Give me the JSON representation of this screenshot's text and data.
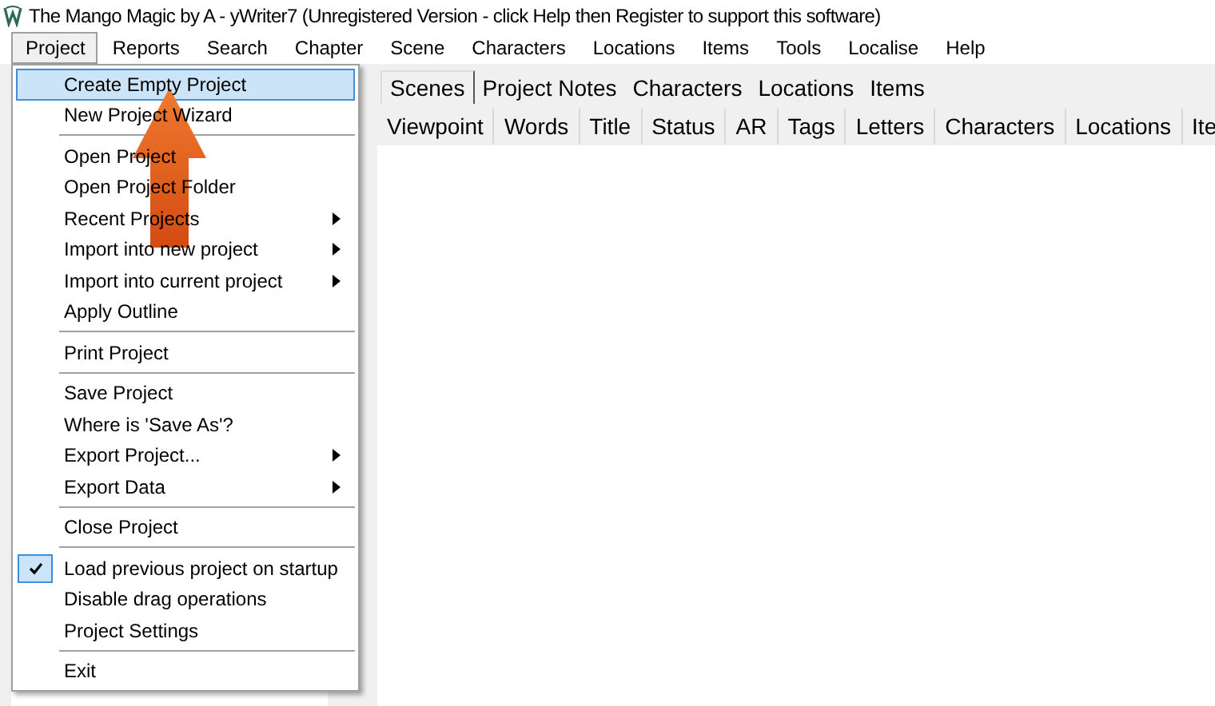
{
  "window": {
    "title": "The Mango Magic by A - yWriter7 (Unregistered Version - click Help then Register to support this software)"
  },
  "menubar": [
    {
      "label": "Project",
      "selected": true
    },
    {
      "label": "Reports",
      "selected": false
    },
    {
      "label": "Search",
      "selected": false
    },
    {
      "label": "Chapter",
      "selected": false
    },
    {
      "label": "Scene",
      "selected": false
    },
    {
      "label": "Characters",
      "selected": false
    },
    {
      "label": "Locations",
      "selected": false
    },
    {
      "label": "Items",
      "selected": false
    },
    {
      "label": "Tools",
      "selected": false
    },
    {
      "label": "Localise",
      "selected": false
    },
    {
      "label": "Help",
      "selected": false
    }
  ],
  "menu": [
    {
      "kind": "item",
      "label": "Create Empty Project",
      "selected": true,
      "submenu": false,
      "checked": false
    },
    {
      "kind": "item",
      "label": "New Project Wizard",
      "selected": false,
      "submenu": false,
      "checked": false
    },
    {
      "kind": "separator"
    },
    {
      "kind": "item",
      "label": "Open Project",
      "selected": false,
      "submenu": false,
      "checked": false
    },
    {
      "kind": "item",
      "label": "Open Project Folder",
      "selected": false,
      "submenu": false,
      "checked": false
    },
    {
      "kind": "item",
      "label": "Recent Projects",
      "selected": false,
      "submenu": true,
      "checked": false
    },
    {
      "kind": "item",
      "label": "Import into new project",
      "selected": false,
      "submenu": true,
      "checked": false
    },
    {
      "kind": "item",
      "label": "Import into current project",
      "selected": false,
      "submenu": true,
      "checked": false
    },
    {
      "kind": "item",
      "label": "Apply Outline",
      "selected": false,
      "submenu": false,
      "checked": false
    },
    {
      "kind": "separator"
    },
    {
      "kind": "item",
      "label": "Print Project",
      "selected": false,
      "submenu": false,
      "checked": false
    },
    {
      "kind": "separator"
    },
    {
      "kind": "item",
      "label": "Save Project",
      "selected": false,
      "submenu": false,
      "checked": false
    },
    {
      "kind": "item",
      "label": "Where is 'Save As'?",
      "selected": false,
      "submenu": false,
      "checked": false
    },
    {
      "kind": "item",
      "label": "Export Project...",
      "selected": false,
      "submenu": true,
      "checked": false
    },
    {
      "kind": "item",
      "label": "Export Data",
      "selected": false,
      "submenu": true,
      "checked": false
    },
    {
      "kind": "separator"
    },
    {
      "kind": "item",
      "label": "Close Project",
      "selected": false,
      "submenu": false,
      "checked": false
    },
    {
      "kind": "separator"
    },
    {
      "kind": "item",
      "label": "Load previous project on startup",
      "selected": false,
      "submenu": false,
      "checked": true
    },
    {
      "kind": "item",
      "label": "Disable drag operations",
      "selected": false,
      "submenu": false,
      "checked": false
    },
    {
      "kind": "item",
      "label": "Project Settings",
      "selected": false,
      "submenu": false,
      "checked": false
    },
    {
      "kind": "separator"
    },
    {
      "kind": "item",
      "label": "Exit",
      "selected": false,
      "submenu": false,
      "checked": false
    }
  ],
  "tabs": [
    {
      "label": "Scenes",
      "selected": true
    },
    {
      "label": "Project Notes",
      "selected": false
    },
    {
      "label": "Characters",
      "selected": false
    },
    {
      "label": "Locations",
      "selected": false
    },
    {
      "label": "Items",
      "selected": false
    }
  ],
  "table": {
    "columns": [
      "Viewpoint",
      "Words",
      "Title",
      "Status",
      "AR",
      "Tags",
      "Letters",
      "Characters",
      "Locations",
      "Ite"
    ]
  }
}
